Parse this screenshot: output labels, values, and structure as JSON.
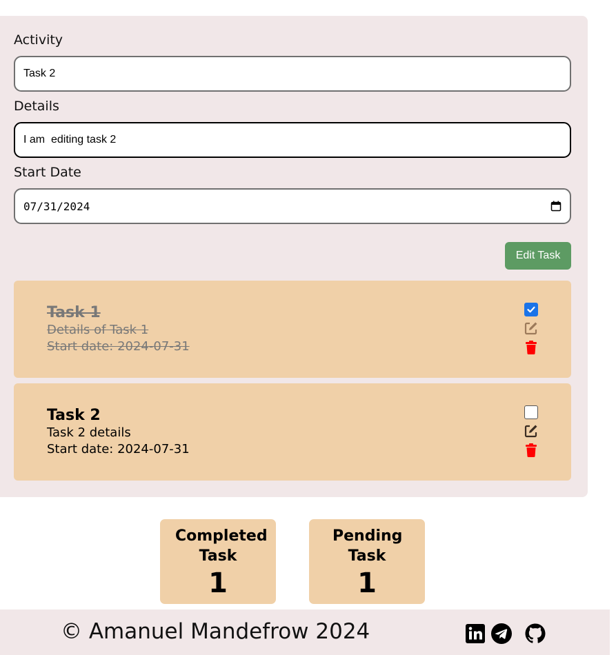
{
  "form": {
    "activity_label": "Activity",
    "activity_value": "Task 2",
    "details_label": "Details",
    "details_value": "I am  editing task 2",
    "start_date_label": "Start Date",
    "start_date_value": "07/31/2024",
    "submit_label": "Edit Task"
  },
  "tasks": [
    {
      "title": "Task 1",
      "details": "Details of Task 1",
      "start_date": "Start date: 2024-07-31",
      "completed": true
    },
    {
      "title": "Task 2",
      "details": "Task 2 details",
      "start_date": "Start date: 2024-07-31",
      "completed": false
    }
  ],
  "stats": {
    "completed_label": "Completed Task",
    "completed_count": "1",
    "pending_label": "Pending Task",
    "pending_count": "1"
  },
  "footer": {
    "copyright": "© Amanuel Mandefrow 2024",
    "social_icons": [
      "linkedin-icon",
      "telegram-icon",
      "github-icon"
    ]
  },
  "colors": {
    "panel_bg": "#f1e7e8",
    "card_bg": "#f0d0a8",
    "button_green": "#5d9b63",
    "delete_red": "#ff0000",
    "checkbox_blue": "#1a73e8"
  }
}
